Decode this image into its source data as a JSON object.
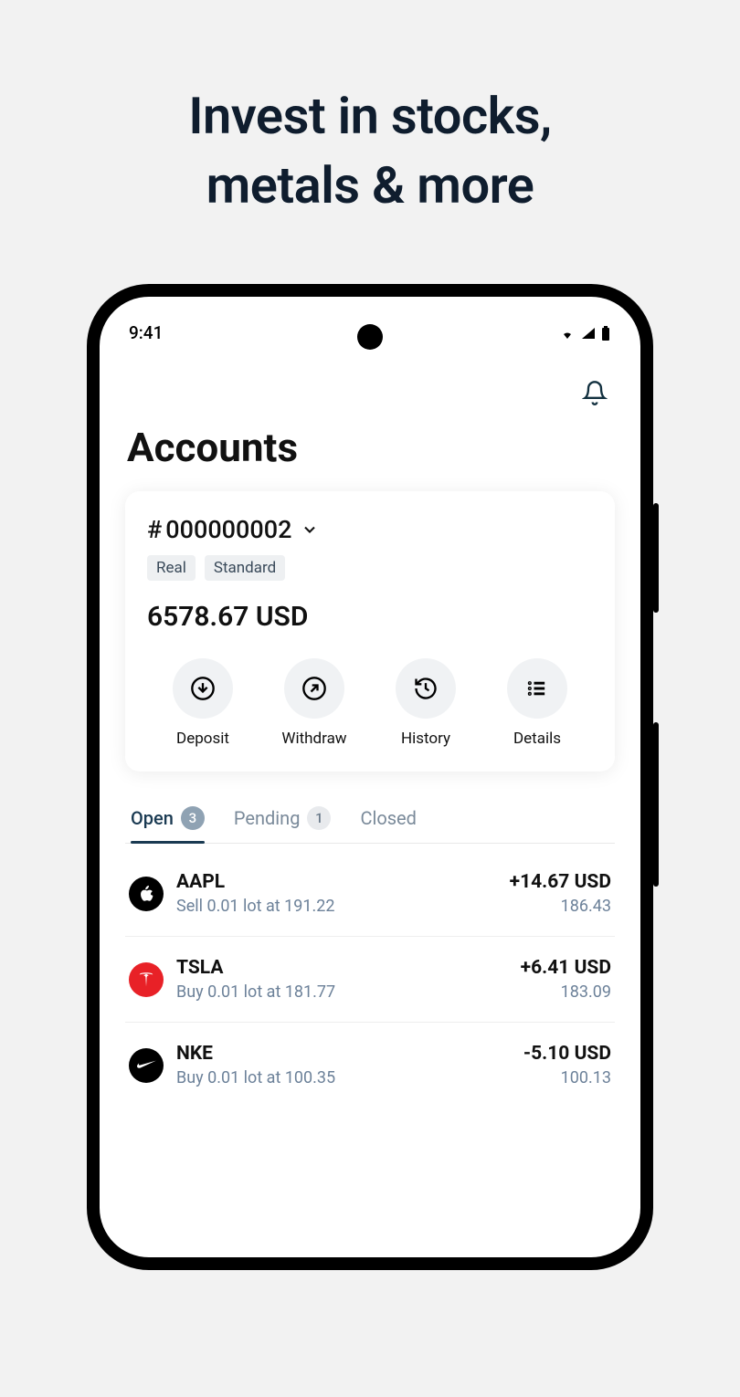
{
  "promo": {
    "title_line1": "Invest in stocks,",
    "title_line2": "metals & more"
  },
  "status": {
    "time": "9:41"
  },
  "header": {
    "title": "Accounts"
  },
  "account": {
    "id_prefix": "#",
    "id": "000000002",
    "tags": [
      "Real",
      "Standard"
    ],
    "balance": "6578.67 USD",
    "actions": [
      {
        "label": "Deposit",
        "icon": "download"
      },
      {
        "label": "Withdraw",
        "icon": "arrow-up-right"
      },
      {
        "label": "History",
        "icon": "history"
      },
      {
        "label": "Details",
        "icon": "list"
      }
    ]
  },
  "tabs": [
    {
      "label": "Open",
      "count": "3",
      "active": true
    },
    {
      "label": "Pending",
      "count": "1",
      "active": false
    },
    {
      "label": "Closed",
      "count": "",
      "active": false
    }
  ],
  "positions": [
    {
      "symbol": "AAPL",
      "logo": "apple",
      "logo_bg": "black",
      "detail": "Sell 0.01 lot at 191.22",
      "profit": "+14.67 USD",
      "profit_class": "positive",
      "price": "186.43"
    },
    {
      "symbol": "TSLA",
      "logo": "tesla",
      "logo_bg": "red",
      "detail": "Buy 0.01 lot at 181.77",
      "profit": "+6.41 USD",
      "profit_class": "positive",
      "price": "183.09"
    },
    {
      "symbol": "NKE",
      "logo": "nike",
      "logo_bg": "black",
      "detail": "Buy 0.01 lot at 100.35",
      "profit": "-5.10 USD",
      "profit_class": "negative",
      "price": "100.13"
    }
  ]
}
